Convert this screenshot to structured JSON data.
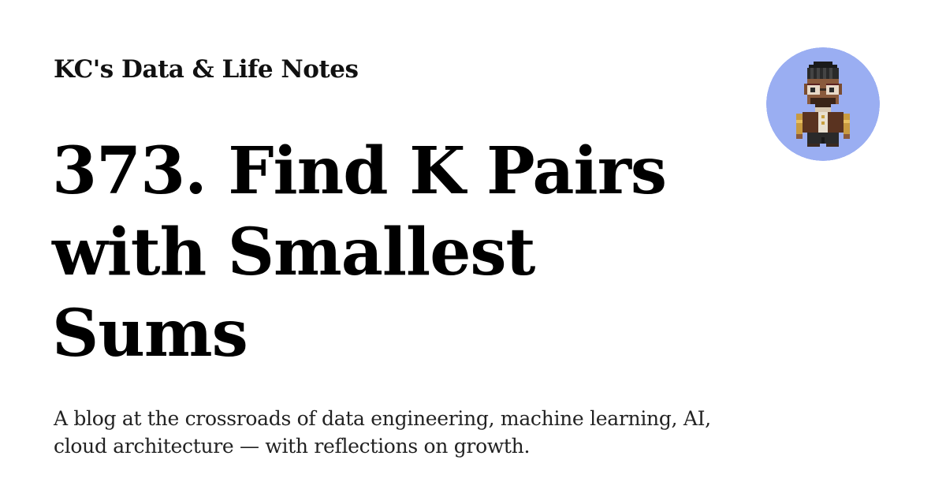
{
  "site": {
    "name": "KC's Data & Life Notes"
  },
  "post": {
    "title": "373. Find K Pairs with Smallest Sums",
    "tagline": "A blog at the crossroads of data engineering, machine learning, AI, cloud architecture — with reflections on growth."
  },
  "avatar": {
    "icon": "pixel-art-person-avatar",
    "background_color": "#9aaef2"
  }
}
